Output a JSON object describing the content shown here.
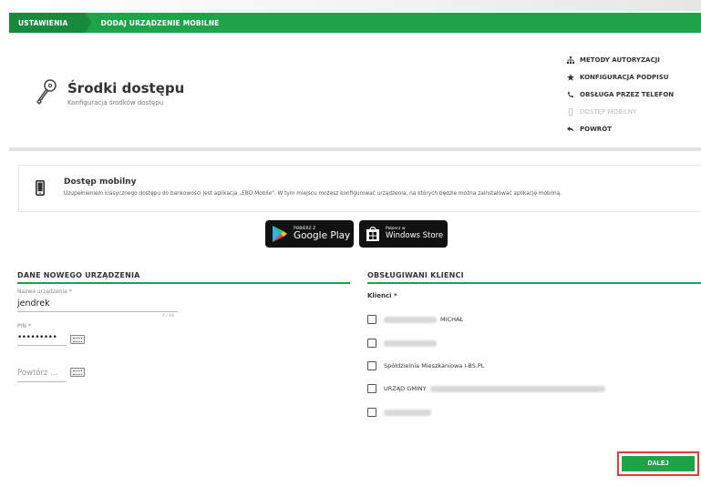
{
  "breadcrumb": {
    "items": [
      "USTAWIENIA",
      "DODAJ URZĄDZENIE MOBILNE"
    ]
  },
  "header": {
    "title": "Środki dostępu",
    "subtitle": "Konfiguracja środków dostępu",
    "icon": "key-icon"
  },
  "side_menu": {
    "items": [
      {
        "label": "METODY AUTORYZACJI",
        "icon": "sitemap-icon",
        "disabled": false
      },
      {
        "label": "KONFIGURACJA PODPISU",
        "icon": "star-icon",
        "disabled": false
      },
      {
        "label": "OBSŁUGA PRZEZ TELEFON",
        "icon": "phone-icon",
        "disabled": false
      },
      {
        "label": "DOSTĘP MOBILNY",
        "icon": "mobile-icon",
        "disabled": true
      },
      {
        "label": "POWRÓT",
        "icon": "back-arrow-icon",
        "disabled": false
      }
    ]
  },
  "info": {
    "title": "Dostęp mobilny",
    "text": "Uzupełnieniem klasycznego dostępu do bankowości jest aplikacja „EBO Mobile\". W tym miejscu możesz konfigurować urządzenia, na których będzie można zainstalować aplikację mobilną."
  },
  "stores": {
    "google_small": "POBIERZ Z",
    "google_big": "Google Play",
    "windows_small": "Pobierz w",
    "windows_big": "Windows Store"
  },
  "new_device": {
    "section_title": "DANE NOWEGO URZĄDZENIA",
    "name_label": "Nazwa urządzenia *",
    "name_value": "jendrek",
    "name_counter": "7 / 16",
    "pin_label": "PIN *",
    "pin_value": "•••••••••",
    "repeat_placeholder": "Powtórz ..."
  },
  "clients": {
    "section_title": "OBSŁUGIWANI KLIENCI",
    "label": "Klienci *",
    "items": [
      {
        "text": "MICHAŁ",
        "checked": false
      },
      {
        "text": "",
        "checked": false
      },
      {
        "text": "Spółdzielnia Mieszkaniowa I-BS.PL",
        "checked": false
      },
      {
        "text": "URZĄD GMINY",
        "checked": false
      },
      {
        "text": "",
        "checked": false
      }
    ]
  },
  "actions": {
    "next_label": "DALEJ"
  },
  "colors": {
    "accent": "#1ea34a",
    "accent_dark": "#178a3d",
    "highlight": "#e53935"
  }
}
